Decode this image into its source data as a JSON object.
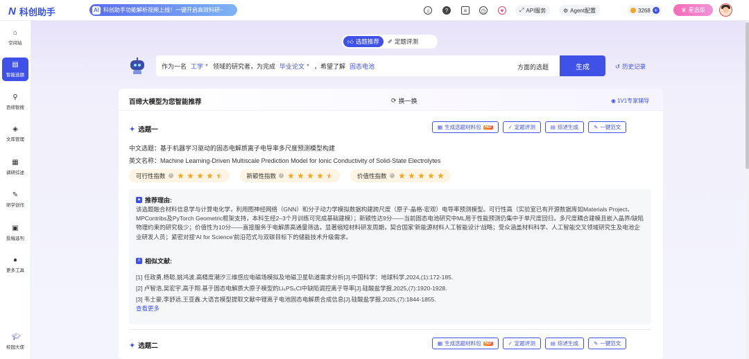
{
  "app": {
    "logo_mark": "N",
    "name": "科创助手"
  },
  "banner": {
    "icon": "AI",
    "text": "科创助手功能解析视频上线！一键开启高效科研~"
  },
  "topbar": {
    "icons": [
      "headset-icon",
      "help-icon",
      "document-icon",
      "history-icon",
      "heart-icon"
    ],
    "api_label": "API服务",
    "agent_label": "Agent配置",
    "coins": "3268",
    "vip_label": "星选版"
  },
  "sidebar": {
    "items": [
      {
        "label": "空间站",
        "icon": "home-icon",
        "glyph": "⌂"
      },
      {
        "label": "智能选题",
        "icon": "topic-icon",
        "glyph": "▤"
      },
      {
        "label": "百缔智搜",
        "icon": "search-icon",
        "glyph": "⚲"
      },
      {
        "label": "文库管理",
        "icon": "library-icon",
        "glyph": "◈"
      },
      {
        "label": "调研综述",
        "icon": "book-icon",
        "glyph": "▦"
      },
      {
        "label": "研学创作",
        "icon": "edit-icon",
        "glyph": "✎"
      },
      {
        "label": "投稿选刊",
        "icon": "journal-icon",
        "glyph": "▣"
      },
      {
        "label": "更多工具",
        "icon": "more-icon",
        "glyph": "●"
      }
    ],
    "bottom_label": "校园大使",
    "active_index": 1
  },
  "modes": {
    "recommend": "选题推荐",
    "evaluate": "定题评测"
  },
  "prompt": {
    "prefix": "作为一名",
    "field": "工学",
    "mid": "领域的研究者，为完成",
    "purpose": "毕业论文",
    "mid2": "，希望了解",
    "keyword": "固态电池",
    "suffix": "方面的选题",
    "generate": "生成"
  },
  "history_label": "历史记录",
  "panel": {
    "title": "百缔大模型为您智能推荐",
    "refresh": "换一换",
    "expert": "1V1专家辅导"
  },
  "actions": {
    "materials": "生成选题材料包",
    "hot": "Hot",
    "evaluate": "定题评测",
    "review": "综述生成",
    "draft": "一键范文"
  },
  "topics": [
    {
      "label": "选题一",
      "cn_prefix": "中文选题：",
      "cn_title": "基于机器学习驱动的固态电解质离子电导率多尺度预测模型构建",
      "en_prefix": "英文名称：",
      "en_title": "Machine Learning-Driven Multiscale Prediction Model for Ionic Conductivity of Solid-State Electrolytes",
      "scores": [
        {
          "label": "可行性指数",
          "stars": 4.5
        },
        {
          "label": "新颖性指数",
          "stars": 4.5
        },
        {
          "label": "价值性指数",
          "stars": 5
        }
      ],
      "reason_title": "推荐理由:",
      "reason": "该选题融合材料信息学与计算电化学，利用图神经网络（GNN）和分子动力学模拟数据构建跨尺度（原子-晶格-宏观）电导率预测模型。可行性高（实验室已有开源数据库如Materials Project、MPContribs及PyTorch Geometric框架支持，本科生经2–3个月训练可完成基础建模）；新颖性达9分——当前固态电池研究中ML用于性能预测仍集中于单尺度回归，多尺度耦合建模且嵌入晶界/缺陷物理约束的研究极少；价值性为10分——直接服务于电解质高通量筛选，显著缩短材料研发周期，契合国家'新能源材料人工智能设计'战略；受众涵盖材料科学、人工智能交叉领域研究生及电池企业研发人员；紧密对接'AI for Science'前沿范式与双碳目标下的储能技术升级需求。",
      "refs_title": "相似文献:",
      "refs": [
        "[1] 任政勇,杨聪,姚鸿波.高精度潮汐三维感应电磁场模拟及地磁卫星轨道需求分析[J].中国科学：地球科学,2024,(1):172-185.",
        "[2] 卢智浩,吴宏宇,高于翔.基于固态电解质大原子模型的Li₆PS₅Cl中缺陷调控离子导率[J].硅酸盐学报,2025,(7):1920-1928.",
        "[3] 韦士豪,李舒远,王亚鑫.大语言模型提取文献中锂离子电池固态电解质合成信息[J].硅酸盐学报,2025,(7):1844-1855."
      ],
      "more": "查看更多"
    },
    {
      "label": "选题二"
    }
  ],
  "colors": {
    "accent": "#3f51e6",
    "star": "#f5a623",
    "hot": "#ff6a00"
  }
}
